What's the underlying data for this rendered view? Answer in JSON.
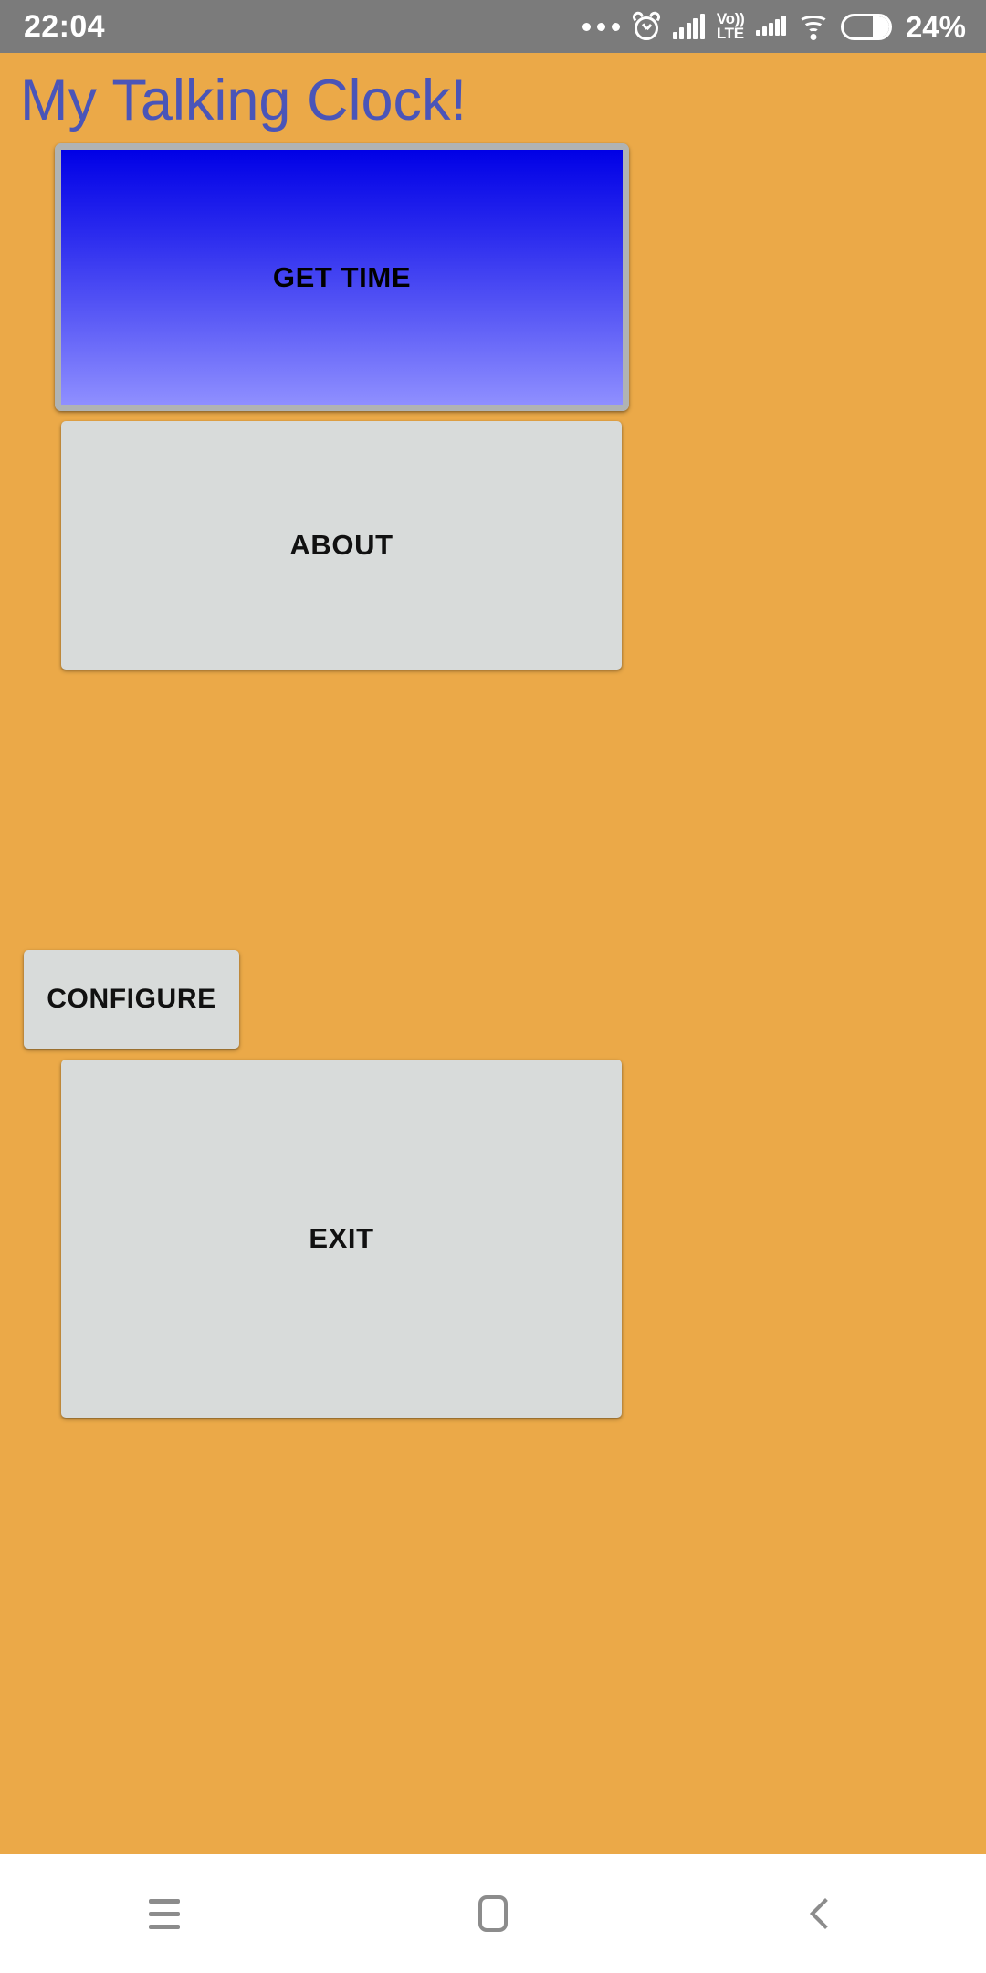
{
  "status_bar": {
    "time": "22:04",
    "battery_percent": "24%",
    "network_label": "Vo))\nLTE",
    "network_line1": "Vo))",
    "network_line2": "LTE",
    "icons": [
      "more-dots-icon",
      "alarm-clock-icon",
      "signal-bars-icon",
      "volte-icon",
      "signal-bars-secondary-icon",
      "wifi-icon",
      "battery-icon"
    ],
    "background_color": "#7b7b7b",
    "foreground_color": "#ffffff"
  },
  "app": {
    "title": "My Talking Clock!",
    "title_color": "#4a55b8",
    "background_color": "#eba948"
  },
  "buttons": [
    {
      "id": "get-time",
      "label": "GET TIME",
      "style": "gradient-blue",
      "gradient_from": "#0000e6",
      "gradient_to": "#8f8fff",
      "border_color": "#b0b3b3",
      "text_color": "#000000"
    },
    {
      "id": "about",
      "label": "ABOUT",
      "style": "grey",
      "background_color": "#d8dbda",
      "text_color": "#111111"
    },
    {
      "id": "configure",
      "label": "CONFIGURE",
      "style": "grey",
      "background_color": "#d8dbda",
      "text_color": "#111111"
    },
    {
      "id": "exit",
      "label": "EXIT",
      "style": "grey",
      "background_color": "#d8dbda",
      "text_color": "#111111"
    }
  ],
  "nav_bar": {
    "background_color": "#ffffff",
    "icon_color": "#8c8c8c",
    "items": [
      {
        "id": "recents",
        "icon": "hamburger-menu-icon"
      },
      {
        "id": "home",
        "icon": "home-square-icon"
      },
      {
        "id": "back",
        "icon": "back-chevron-icon"
      }
    ]
  }
}
